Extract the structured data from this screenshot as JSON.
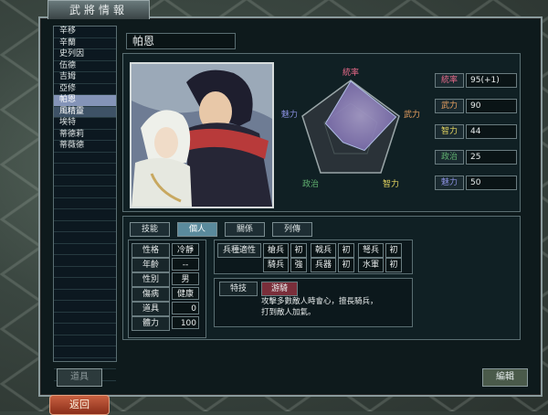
{
  "window": {
    "title": "武將情報"
  },
  "general_list": [
    "辛移",
    "辛蘭",
    "史列因",
    "伍德",
    "吉姆",
    "亞修",
    "帕恩",
    "風精靈",
    "埃特",
    "蒂德莉",
    "蒂薇德",
    "",
    "",
    "",
    "",
    "",
    "",
    "",
    "",
    "",
    "",
    "",
    "",
    "",
    "",
    "",
    "",
    "",
    "",
    "",
    ""
  ],
  "selected_index": 6,
  "highlight_index": 7,
  "general": {
    "name": "帕恩"
  },
  "radar": {
    "labels": {
      "lead": "統率",
      "force": "武力",
      "intel": "智力",
      "politics": "政治",
      "charm": "魅力"
    },
    "values": {
      "lead": 0.95,
      "force": 0.9,
      "intel": 0.44,
      "politics": 0.25,
      "charm": 0.5
    }
  },
  "stats": [
    {
      "label": "統率",
      "value": "95(+1)",
      "color": "#e86a8a"
    },
    {
      "label": "武力",
      "value": "90",
      "color": "#e8a060"
    },
    {
      "label": "智力",
      "value": "44",
      "color": "#e8d860"
    },
    {
      "label": "政治",
      "value": "25",
      "color": "#60b070"
    },
    {
      "label": "魅力",
      "value": "50",
      "color": "#8a90e0"
    }
  ],
  "tabs": [
    "技能",
    "個人",
    "關係",
    "列傳"
  ],
  "active_tab": 1,
  "personal": [
    {
      "label": "性格",
      "value": "冷靜"
    },
    {
      "label": "年齡",
      "value": "--"
    },
    {
      "label": "性別",
      "value": "男"
    },
    {
      "label": "傷病",
      "value": "健康"
    },
    {
      "label": "道具",
      "value": "0"
    },
    {
      "label": "體力",
      "value": "100"
    }
  ],
  "aptitude": {
    "label": "兵種適性",
    "rows": [
      [
        {
          "unit": "槍兵",
          "grade": "初"
        },
        {
          "unit": "戟兵",
          "grade": "初"
        },
        {
          "unit": "弩兵",
          "grade": "初"
        }
      ],
      [
        {
          "unit": "騎兵",
          "grade": "強"
        },
        {
          "unit": "兵器",
          "grade": "初"
        },
        {
          "unit": "水軍",
          "grade": "初"
        }
      ]
    ]
  },
  "skill": {
    "label": "特技",
    "name": "游騎",
    "description_line1": "攻擊多數敵人時會心，擅長騎兵，",
    "description_line2": "打到敵人加氣。"
  },
  "buttons": {
    "item": "道具",
    "edit": "編輯",
    "back": "返回"
  }
}
